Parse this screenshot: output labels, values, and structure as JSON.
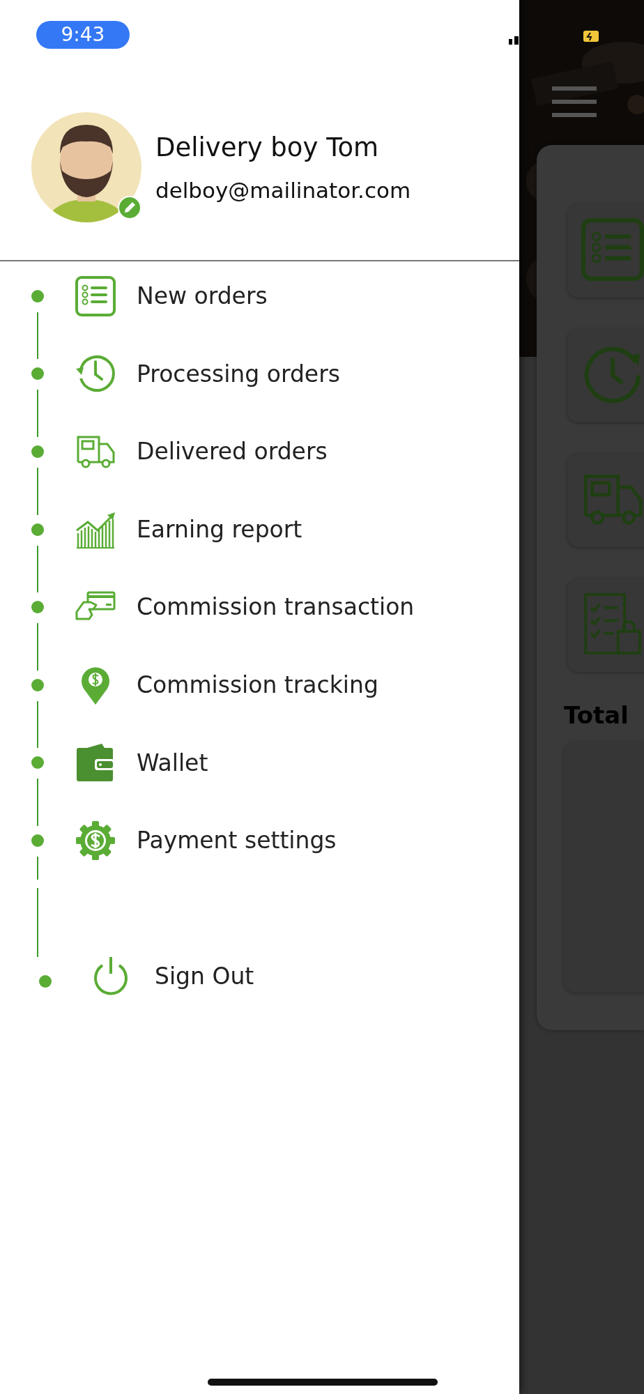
{
  "status_bar": {
    "time": "9:43"
  },
  "profile": {
    "name": "Delivery boy Tom",
    "email": "delboy@mailinator.com"
  },
  "menu": [
    {
      "label": "New orders"
    },
    {
      "label": "Processing orders"
    },
    {
      "label": "Delivered orders"
    },
    {
      "label": "Earning report"
    },
    {
      "label": "Commission transaction"
    },
    {
      "label": "Commission tracking"
    },
    {
      "label": "Wallet"
    },
    {
      "label": "Payment settings"
    }
  ],
  "sign_out": {
    "label": "Sign Out"
  },
  "background_screen": {
    "section_title": "Total"
  }
}
